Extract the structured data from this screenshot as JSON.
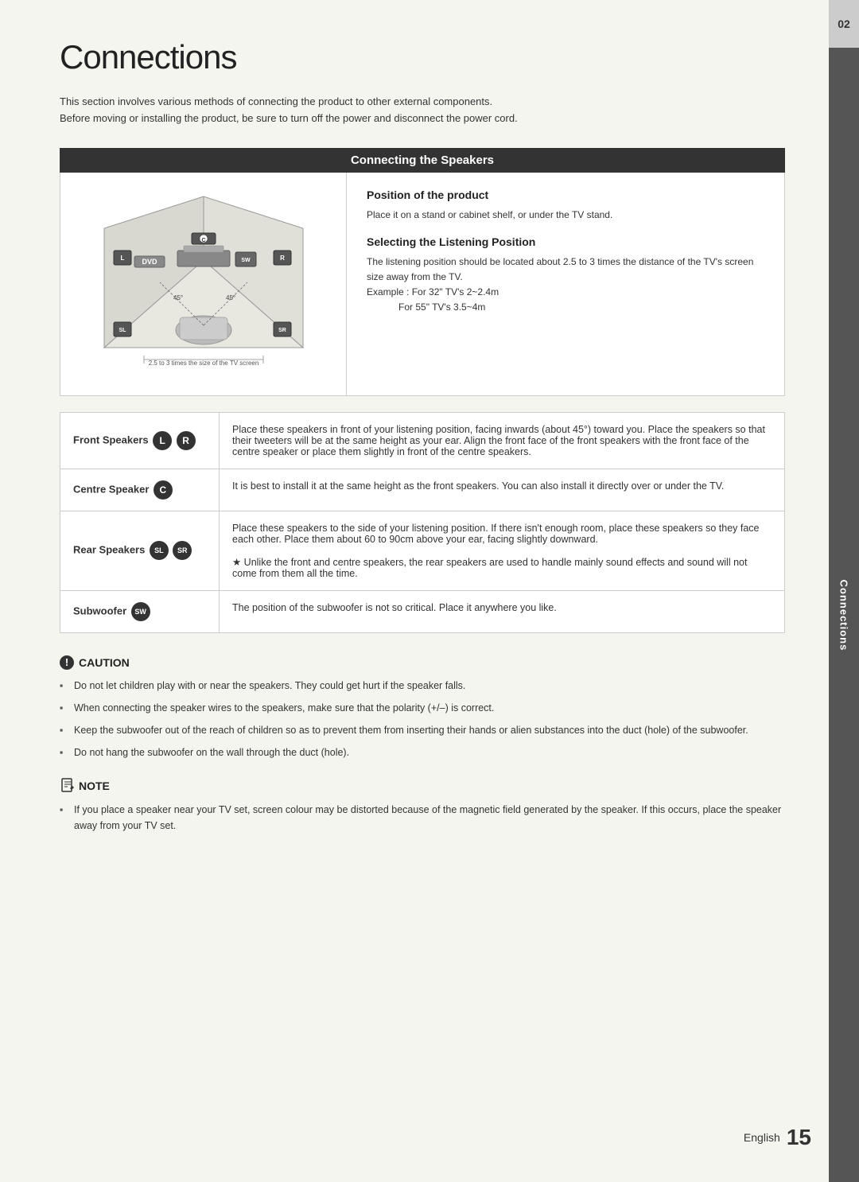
{
  "page": {
    "title": "Connections",
    "page_number": "15",
    "language": "English",
    "section_number": "02",
    "section_label": "Connections"
  },
  "intro": {
    "line1": "This section involves various methods of connecting the product to other external components.",
    "line2": "Before moving or installing the product, be sure to turn off the power and disconnect the power cord."
  },
  "connecting_speakers": {
    "header": "Connecting the Speakers",
    "diagram_label": "2.5 to 3 times the size of the TV screen",
    "position_title": "Position of the product",
    "position_text": "Place it on a stand or cabinet shelf, or under the TV stand.",
    "listening_title": "Selecting the Listening Position",
    "listening_text": "The listening position should be located about 2.5 to 3 times the distance of the TV's screen size away from the TV.",
    "example_line1": "Example : For 32\" TV's 2~2.4m",
    "example_line2": "For 55\" TV's 3.5~4m"
  },
  "speaker_table": {
    "rows": [
      {
        "label": "Front Speakers",
        "badges": [
          "L",
          "R"
        ],
        "description": "Place these speakers in front of your listening position, facing inwards (about 45°) toward you. Place the speakers so that their tweeters will be at the same height as your ear. Align the front face of the front speakers with the front face of the centre speaker or place them slightly in front of the centre speakers."
      },
      {
        "label": "Centre Speaker",
        "badges": [
          "C"
        ],
        "description": "It is best to install it at the same height as the front speakers. You can also install it directly over or under the TV."
      },
      {
        "label": "Rear Speakers",
        "badges": [
          "SL",
          "SR"
        ],
        "description": "Place these speakers to the side of your listening position. If there isn't enough room, place these speakers so they face each other. Place them about 60 to 90cm above your ear, facing slightly downward.\n★ Unlike the front and centre speakers, the rear speakers are used to handle mainly sound effects and sound will not come from them all the time."
      },
      {
        "label": "Subwoofer",
        "badges": [
          "SW"
        ],
        "description": "The position of the subwoofer is not so critical. Place it anywhere you like."
      }
    ]
  },
  "caution": {
    "title": "CAUTION",
    "bullets": [
      "Do not let children play with or near the speakers. They could get hurt if the speaker falls.",
      "When connecting the speaker wires to the speakers, make sure that the polarity (+/–) is correct.",
      "Keep the subwoofer out of the reach of children so as to prevent them from inserting their hands or alien substances into the duct (hole) of the subwoofer.",
      "Do not hang the subwoofer on the wall through the duct (hole)."
    ]
  },
  "note": {
    "title": "NOTE",
    "bullets": [
      "If you place a speaker near your TV set, screen colour may be distorted because of the magnetic field generated by the speaker. If this occurs, place the speaker away from your TV set."
    ]
  }
}
